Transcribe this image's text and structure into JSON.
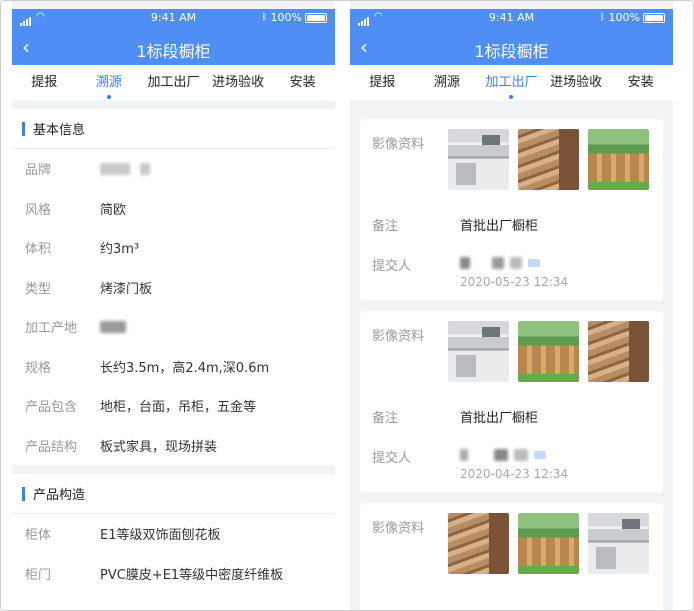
{
  "screens": [
    {
      "status": {
        "time": "9:41 AM",
        "battery": "100%"
      },
      "nav": {
        "title": "1标段橱柜",
        "back_icon": "chevron-left-icon"
      },
      "tabs": [
        "提报",
        "溯源",
        "加工出厂",
        "进场验收",
        "安装"
      ],
      "active_tab": "溯源",
      "basic_info": {
        "heading": "基本信息",
        "rows": [
          {
            "label": "品牌",
            "value": ""
          },
          {
            "label": "风格",
            "value": "简欧"
          },
          {
            "label": "体积",
            "value": "约3m³"
          },
          {
            "label": "类型",
            "value": "烤漆门板"
          },
          {
            "label": "加工产地",
            "value": ""
          },
          {
            "label": "规格",
            "value": "长约3.5m，高2.4m,深0.6m"
          },
          {
            "label": "产品包含",
            "value": "地柜，台面，吊柜，五金等"
          },
          {
            "label": "产品结构",
            "value": "板式家具，现场拼装"
          }
        ]
      },
      "structure": {
        "heading": "产品构造",
        "rows": [
          {
            "label": "柜体",
            "value": "E1等级双饰面刨花板"
          },
          {
            "label": "柜门",
            "value": "PVC膜皮+E1等级中密度纤维板"
          }
        ]
      }
    },
    {
      "status": {
        "time": "9:41 AM",
        "battery": "100%"
      },
      "nav": {
        "title": "1标段橱柜",
        "back_icon": "chevron-left-icon"
      },
      "tabs": [
        "提报",
        "溯源",
        "加工出厂",
        "进场验收",
        "安装"
      ],
      "active_tab": "加工出厂",
      "labels": {
        "media": "影像资料",
        "note": "备注",
        "submitter": "提交人"
      },
      "records": [
        {
          "images": [
            "kitchen",
            "wood",
            "crates"
          ],
          "note": "首批出厂橱柜",
          "date": "2020-05-23 12:34"
        },
        {
          "images": [
            "kitchen",
            "crates",
            "wood"
          ],
          "note": "首批出厂橱柜",
          "date": "2020-04-23 12:34"
        },
        {
          "images": [
            "wood",
            "crates",
            "kitchen"
          ]
        }
      ]
    }
  ]
}
